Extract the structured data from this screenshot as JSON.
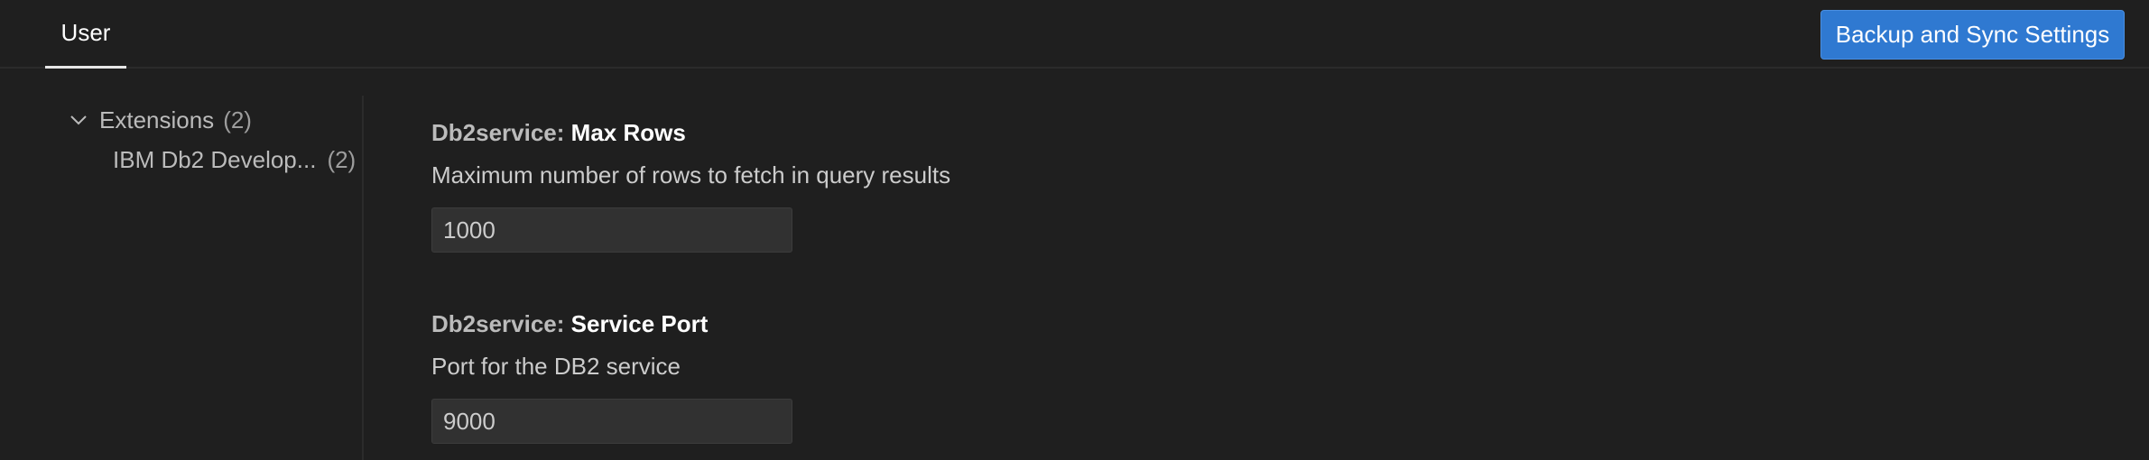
{
  "header": {
    "tab_label": "User",
    "sync_button_label": "Backup and Sync Settings"
  },
  "toc": {
    "items": [
      {
        "label": "Extensions",
        "count": "(2)",
        "icon": "chevron-down-icon"
      },
      {
        "label": "IBM Db2 Develop...",
        "count": "(2)"
      }
    ]
  },
  "settings": [
    {
      "category": "Db2service: ",
      "name": "Max Rows",
      "description": "Maximum number of rows to fetch in query results",
      "value": "1000"
    },
    {
      "category": "Db2service: ",
      "name": "Service Port",
      "description": "Port for the DB2 service",
      "value": "9000"
    }
  ]
}
